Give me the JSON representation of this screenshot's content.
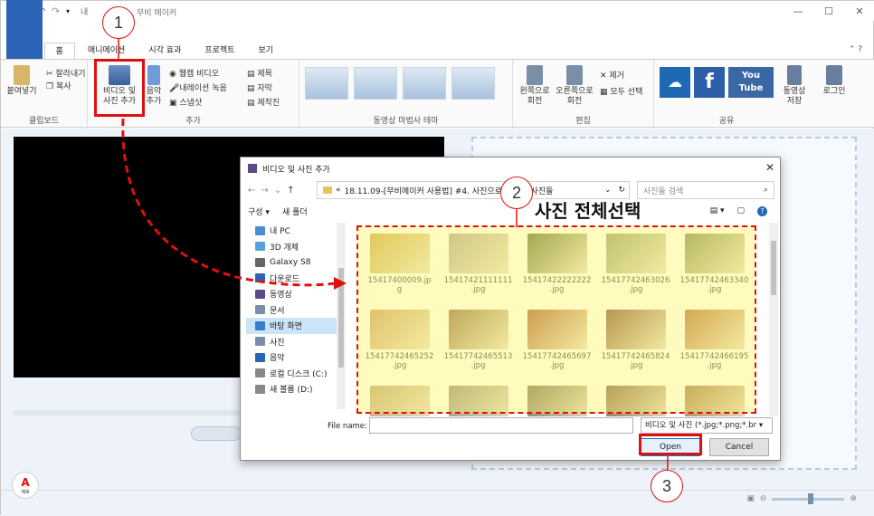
{
  "app": {
    "title": "무비 메이커",
    "title_prefix": "내",
    "window_controls": [
      "—",
      "☐",
      "✕"
    ]
  },
  "tabs": [
    "파일",
    "홈",
    "애니메이션",
    "시각 효과",
    "프로젝트",
    "보기"
  ],
  "ribbon": {
    "clipboard": {
      "paste": "붙여넣기",
      "cut": "잘라내기",
      "copy": "복사",
      "label": "클립보드"
    },
    "add": {
      "add_videos_line1": "비디오 및",
      "add_videos_line2": "사진 추가",
      "music_line1": "음악",
      "music_line2": "추가",
      "webcam": "웹캠 비디오",
      "narration": "내레이션 녹음",
      "snapshot": "스냅샷",
      "title": "제목",
      "caption": "자막",
      "credits": "제작진",
      "label": "추가"
    },
    "themes": {
      "label": "동영상 마법사 테마"
    },
    "edit": {
      "rotate_left_1": "왼쪽으로",
      "rotate_left_2": "회전",
      "rotate_right_1": "오른쪽으로",
      "rotate_right_2": "회전",
      "remove": "제거",
      "select_all": "모두 선택",
      "label": "편집"
    },
    "share": {
      "label": "공유",
      "save_movie_1": "동영상",
      "save_movie_2": "저장",
      "signin": "로그인",
      "youtube_1": "You",
      "youtube_2": "Tube"
    }
  },
  "dialog": {
    "title": "비디오 및 사진 추가",
    "breadcrumb_prefix": "«",
    "breadcrumb": "18.11.09-[무비메이커 사용법] #4. 사진으로",
    "breadcrumb_last": "사진들",
    "search_placeholder": "사진들 검색",
    "toolbar": {
      "organize": "구성 ▾",
      "new_folder": "새 폴더"
    },
    "nav_items": [
      {
        "label": "내 PC",
        "icon": "pc-icon"
      },
      {
        "label": "3D 개체",
        "icon": "cube-icon"
      },
      {
        "label": "Galaxy S8",
        "icon": "phone-icon"
      },
      {
        "label": "다운로드",
        "icon": "download-icon"
      },
      {
        "label": "동영상",
        "icon": "video-icon"
      },
      {
        "label": "문서",
        "icon": "document-icon"
      },
      {
        "label": "바탕 화면",
        "icon": "desktop-icon"
      },
      {
        "label": "사진",
        "icon": "picture-icon"
      },
      {
        "label": "음악",
        "icon": "music-icon"
      },
      {
        "label": "로컬 디스크 (C:)",
        "icon": "drive-icon"
      },
      {
        "label": "새 볼륨 (D:)",
        "icon": "drive-icon"
      }
    ],
    "files": [
      {
        "name1": "15417400009.jp",
        "name2": "g",
        "color": "#c9a54a"
      },
      {
        "name1": "15417421111111",
        "name2": ".jpg",
        "color": "#a8a49c"
      },
      {
        "name1": "15417422222222",
        "name2": ".jpg",
        "color": "#5a6a3a"
      },
      {
        "name1": "15417742463026",
        "name2": ".jpg",
        "color": "#8e9c72"
      },
      {
        "name1": "15417742463340",
        "name2": ".jpg",
        "color": "#7a8a58"
      },
      {
        "name1": "15417742465252",
        "name2": ".jpg",
        "color": "#c79a6a"
      },
      {
        "name1": "15417742465513",
        "name2": ".jpg",
        "color": "#8a6a4a"
      },
      {
        "name1": "15417742465697",
        "name2": ".jpg",
        "color": "#a5563a"
      },
      {
        "name1": "15417742465824",
        "name2": ".jpg",
        "color": "#7a4a38"
      },
      {
        "name1": "15417742466195",
        "name2": ".jpg",
        "color": "#b46a3a"
      },
      {
        "name1": "",
        "name2": "",
        "color": "#b8a27a"
      },
      {
        "name1": "",
        "name2": "",
        "color": "#8c8a84"
      },
      {
        "name1": "",
        "name2": "",
        "color": "#6f6a5a"
      },
      {
        "name1": "",
        "name2": "",
        "color": "#7c5e46"
      },
      {
        "name1": "",
        "name2": "",
        "color": "#a0744a"
      }
    ],
    "file_name_label": "File name:",
    "file_type": "비디오 및 사진 (*.jpg;*.png;*.br ▾",
    "open": "Open",
    "cancel": "Cancel"
  },
  "annotations": {
    "callout_1": "1",
    "callout_2": "2",
    "callout_3": "3",
    "select_all_label": "사진 전체선택",
    "accent_color": "#e01010",
    "highlight_color": "#fff56e"
  },
  "logo_text": "에포"
}
